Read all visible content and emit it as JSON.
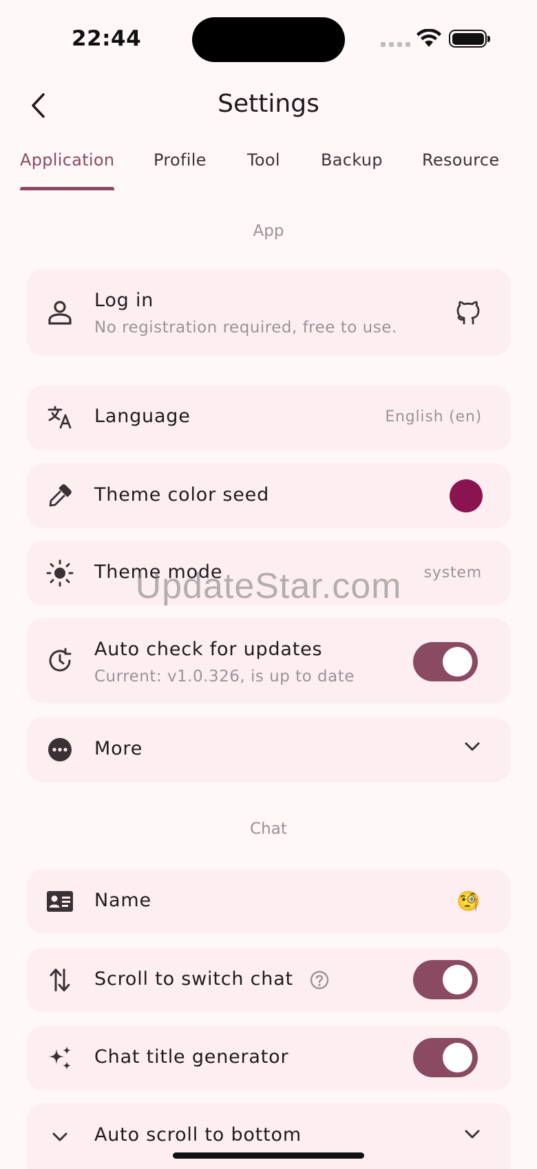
{
  "status_bar": {
    "time": "22:44"
  },
  "header": {
    "title": "Settings"
  },
  "tabs": [
    {
      "label": "Application",
      "active": true
    },
    {
      "label": "Profile"
    },
    {
      "label": "Tool"
    },
    {
      "label": "Backup"
    },
    {
      "label": "Resource"
    }
  ],
  "sections": {
    "app": {
      "title": "App",
      "login": {
        "label": "Log in",
        "subtitle": "No registration required, free to use."
      },
      "language": {
        "label": "Language",
        "value": "English (en)"
      },
      "theme_seed": {
        "label": "Theme color seed",
        "color": "#8a1452"
      },
      "theme_mode": {
        "label": "Theme mode",
        "value": "system"
      },
      "auto_update": {
        "label": "Auto check for updates",
        "subtitle": "Current: v1.0.326, is up to date",
        "enabled": true
      },
      "more": {
        "label": "More"
      }
    },
    "chat": {
      "title": "Chat",
      "name": {
        "label": "Name",
        "emoji": "🧐"
      },
      "scroll_switch": {
        "label": "Scroll to switch chat",
        "enabled": true
      },
      "title_generator": {
        "label": "Chat title generator",
        "enabled": true
      },
      "auto_scroll": {
        "label": "Auto scroll to bottom"
      }
    }
  },
  "watermark": "UpdateStar.com",
  "colors": {
    "accent": "#8a4a61",
    "card": "#fdeef1",
    "background": "#fff7f8"
  }
}
